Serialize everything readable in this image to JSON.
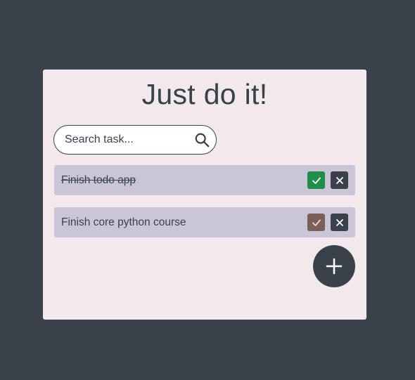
{
  "app": {
    "title": "Just do it!"
  },
  "search": {
    "placeholder": "Search task...",
    "icon": "search-icon"
  },
  "tasks": [
    {
      "label": "Finish todo app",
      "completed": true,
      "complete_icon": "check-icon",
      "delete_icon": "close-icon"
    },
    {
      "label": "Finish core python course",
      "completed": false,
      "complete_icon": "check-icon",
      "delete_icon": "close-icon"
    }
  ],
  "add_button": {
    "icon": "plus-icon"
  },
  "colors": {
    "background": "#3a414b",
    "card": "#f1e9ec",
    "task_row": "#cac6d7",
    "complete_active": "#1e8f4a",
    "complete_inactive": "#7a6059",
    "delete": "#3a414b"
  }
}
